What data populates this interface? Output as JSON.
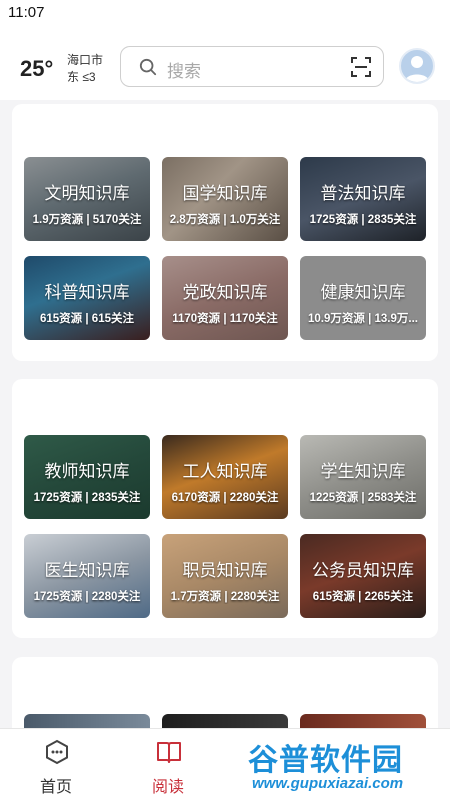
{
  "status_bar": {
    "time": "11:07"
  },
  "header": {
    "temperature": "25°",
    "city": "海口市",
    "wind": "东 ≤3",
    "search_placeholder": "搜索"
  },
  "sections": [
    {
      "tiles": [
        {
          "title": "文明知识库",
          "stats": "1.9万资源 | 5170关注"
        },
        {
          "title": "国学知识库",
          "stats": "2.8万资源 | 1.0万关注"
        },
        {
          "title": "普法知识库",
          "stats": "1725资源 | 2835关注"
        },
        {
          "title": "科普知识库",
          "stats": "615资源 | 615关注"
        },
        {
          "title": "党政知识库",
          "stats": "1170资源 | 1170关注"
        },
        {
          "title": "健康知识库",
          "stats": "10.9万资源 | 13.9万..."
        }
      ]
    },
    {
      "tiles": [
        {
          "title": "教师知识库",
          "stats": "1725资源 | 2835关注"
        },
        {
          "title": "工人知识库",
          "stats": "6170资源 | 2280关注"
        },
        {
          "title": "学生知识库",
          "stats": "1225资源 | 2583关注"
        },
        {
          "title": "医生知识库",
          "stats": "1725资源 | 2280关注"
        },
        {
          "title": "职员知识库",
          "stats": "1.7万资源 | 2280关注"
        },
        {
          "title": "公务员知识库",
          "stats": "615资源 | 2265关注"
        }
      ]
    }
  ],
  "tab_bar": {
    "tabs": [
      {
        "label": "首页",
        "icon": "home-hexagon-icon",
        "active": false
      },
      {
        "label": "阅读",
        "icon": "book-icon",
        "active": true
      },
      {
        "label": "",
        "icon": "partially-hidden-icon",
        "active": false
      },
      {
        "label": "",
        "icon": "partially-hidden-icon",
        "active": false
      }
    ]
  },
  "watermark": {
    "brand": "谷普软件园",
    "url": "www.gupuxiazai.com"
  },
  "colors": {
    "accent": "#c8303a",
    "watermark": "#1d8fd8"
  }
}
